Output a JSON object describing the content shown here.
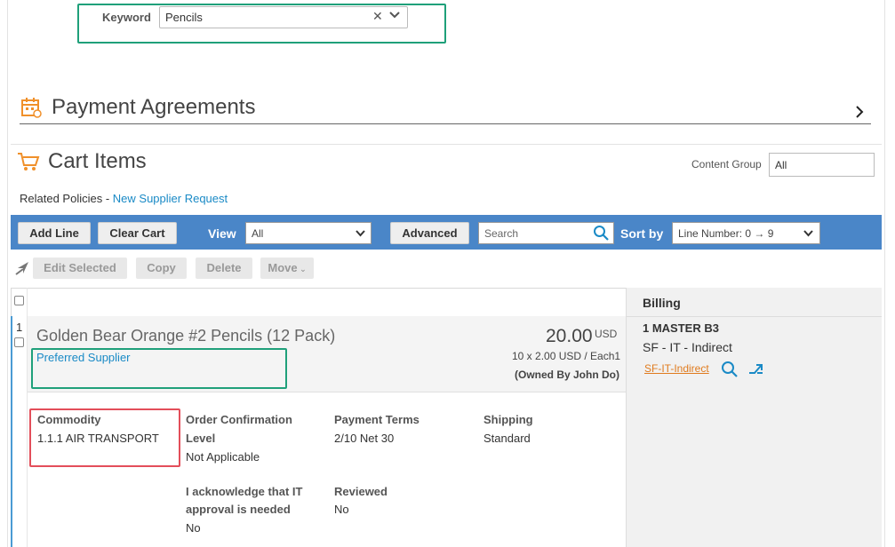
{
  "keyword": {
    "label": "Keyword",
    "value": "Pencils"
  },
  "payment_agreements": {
    "title": "Payment Agreements"
  },
  "cart": {
    "title": "Cart Items",
    "content_group_label": "Content Group",
    "content_group_value": "All",
    "related_policies_label": "Related Policies -",
    "related_policies_link": "New Supplier Request"
  },
  "toolbar": {
    "add_line": "Add Line",
    "clear_cart": "Clear Cart",
    "view_label": "View",
    "view_value": "All",
    "advanced": "Advanced",
    "search_placeholder": "Search",
    "sort_label": "Sort by",
    "sort_value": "Line Number: 0 → 9"
  },
  "edit_toolbar": {
    "edit_selected": "Edit Selected",
    "copy": "Copy",
    "delete": "Delete",
    "move": "Move"
  },
  "billing": {
    "header": "Billing",
    "account": "1 MASTER B3",
    "segment": "SF - IT - Indirect",
    "link": "SF-IT-Indirect"
  },
  "item": {
    "line_number": "1",
    "name": "Golden Bear Orange #2 Pencils (12 Pack)",
    "supplier_label": "Preferred Supplier",
    "price": "20.00",
    "currency": "USD",
    "unit_line": "10 x 2.00 USD / Each1",
    "owner": "(Owned By John Do)",
    "details": {
      "commodity_label": "Commodity",
      "commodity_value": "1.1.1 AIR TRANSPORT",
      "order_conf_label_1": "Order Confirmation",
      "order_conf_label_2": "Level",
      "order_conf_value": "Not Applicable",
      "payment_terms_label": "Payment Terms",
      "payment_terms_value": "2/10 Net 30",
      "shipping_label": "Shipping",
      "shipping_value": "Standard",
      "ack_label_1": "I acknowledge that IT",
      "ack_label_2": "approval is needed",
      "ack_value": "No",
      "reviewed_label": "Reviewed",
      "reviewed_value": "No"
    }
  },
  "colors": {
    "toolbar_blue": "#4a86c8",
    "link_blue": "#1a8ac6",
    "billing_link_orange": "#e07b1e",
    "highlight_green": "#1fa07a",
    "highlight_red": "#e34e5a",
    "icon_orange": "#f0902a"
  }
}
